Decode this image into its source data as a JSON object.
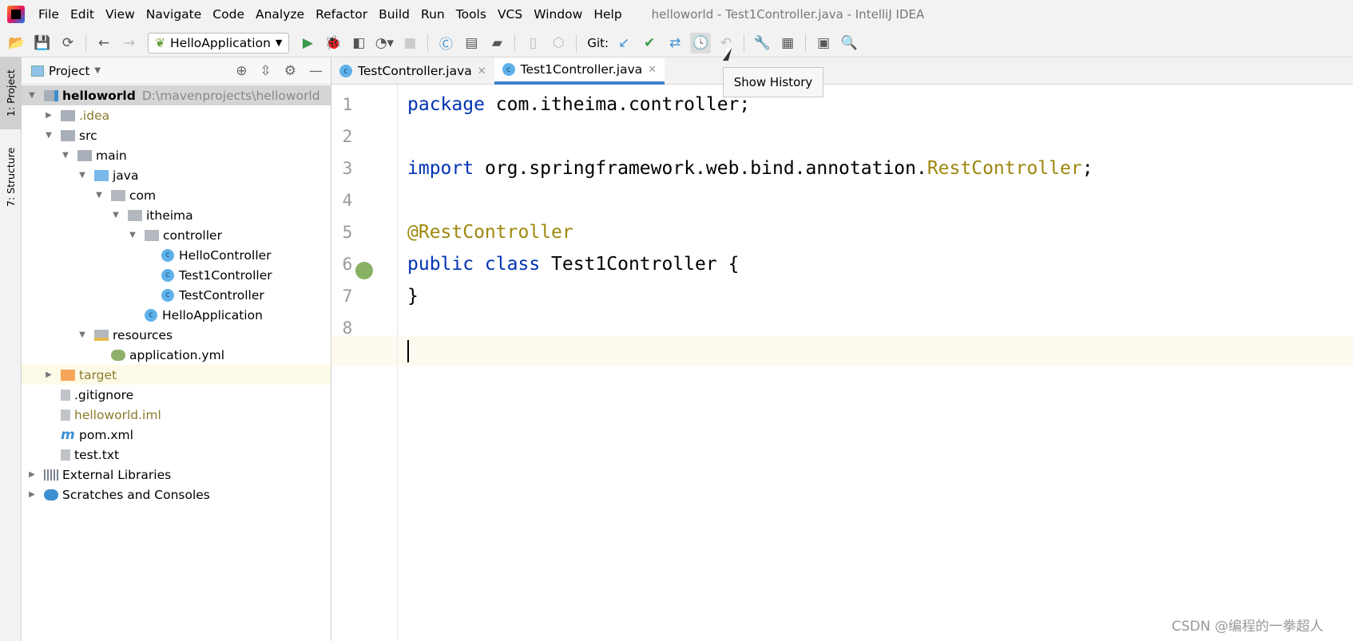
{
  "menubar": {
    "items": [
      "File",
      "Edit",
      "View",
      "Navigate",
      "Code",
      "Analyze",
      "Refactor",
      "Build",
      "Run",
      "Tools",
      "VCS",
      "Window",
      "Help"
    ],
    "title": "helloworld - Test1Controller.java - IntelliJ IDEA"
  },
  "toolbar": {
    "run_config": "HelloApplication",
    "git_label": "Git:"
  },
  "left_stripe": {
    "project": "1: Project",
    "structure": "7: Structure"
  },
  "panel": {
    "title": "Project"
  },
  "tree": [
    {
      "label": "helloworld",
      "path": "D:\\mavenprojects\\helloworld",
      "depth": 0,
      "arrow": "down",
      "icon": "module-folder"
    },
    {
      "label": ".idea",
      "depth": 1,
      "arrow": "right",
      "icon": "folder"
    },
    {
      "label": "src",
      "depth": 1,
      "arrow": "down",
      "icon": "folder"
    },
    {
      "label": "main",
      "depth": 2,
      "arrow": "down",
      "icon": "folder"
    },
    {
      "label": "java",
      "depth": 3,
      "arrow": "down",
      "icon": "source-folder"
    },
    {
      "label": "com",
      "depth": 4,
      "arrow": "down",
      "icon": "package"
    },
    {
      "label": "itheima",
      "depth": 5,
      "arrow": "down",
      "icon": "package"
    },
    {
      "label": "controller",
      "depth": 6,
      "arrow": "down",
      "icon": "package"
    },
    {
      "label": "HelloController",
      "depth": 7,
      "icon": "class"
    },
    {
      "label": "Test1Controller",
      "depth": 7,
      "icon": "class"
    },
    {
      "label": "TestController",
      "depth": 7,
      "icon": "class"
    },
    {
      "label": "HelloApplication",
      "depth": 6,
      "icon": "spring-boot-class"
    },
    {
      "label": "resources",
      "depth": 3,
      "arrow": "down",
      "icon": "resources-folder"
    },
    {
      "label": "application.yml",
      "depth": 4,
      "icon": "spring-config"
    },
    {
      "label": "target",
      "depth": 1,
      "arrow": "right",
      "icon": "excluded-folder"
    },
    {
      "label": ".gitignore",
      "depth": 1,
      "icon": "ignore-file"
    },
    {
      "label": "helloworld.iml",
      "depth": 1,
      "icon": "iml-file"
    },
    {
      "label": "pom.xml",
      "depth": 1,
      "icon": "maven"
    },
    {
      "label": "test.txt",
      "depth": 1,
      "icon": "text-file"
    },
    {
      "label": "External Libraries",
      "depth": 0,
      "arrow": "right",
      "icon": "libraries"
    },
    {
      "label": "Scratches and Consoles",
      "depth": 0,
      "arrow": "right",
      "icon": "scratches"
    }
  ],
  "tabs": [
    {
      "label": "TestController.java",
      "active": false
    },
    {
      "label": "Test1Controller.java",
      "active": true
    }
  ],
  "code": {
    "line_numbers": [
      "1",
      "2",
      "3",
      "4",
      "5",
      "6",
      "7",
      "8"
    ],
    "l1_kw": "package",
    "l1_rest": " com.itheima.controller;",
    "l3_kw": "import",
    "l3_rest": " org.springframework.web.bind.annotation.",
    "l3_ann": "RestController",
    "l3_end": ";",
    "l5_ann": "@RestController",
    "l6_kw": "public class",
    "l6_rest": " Test1Controller {",
    "l7": "}"
  },
  "tooltip": "Show History",
  "watermark": "CSDN @编程的一拳超人",
  "colors": {
    "accent": "#4083c9",
    "keyword": "#0033b3",
    "annotation": "#9e880d",
    "current_line": "#fefaf0"
  }
}
